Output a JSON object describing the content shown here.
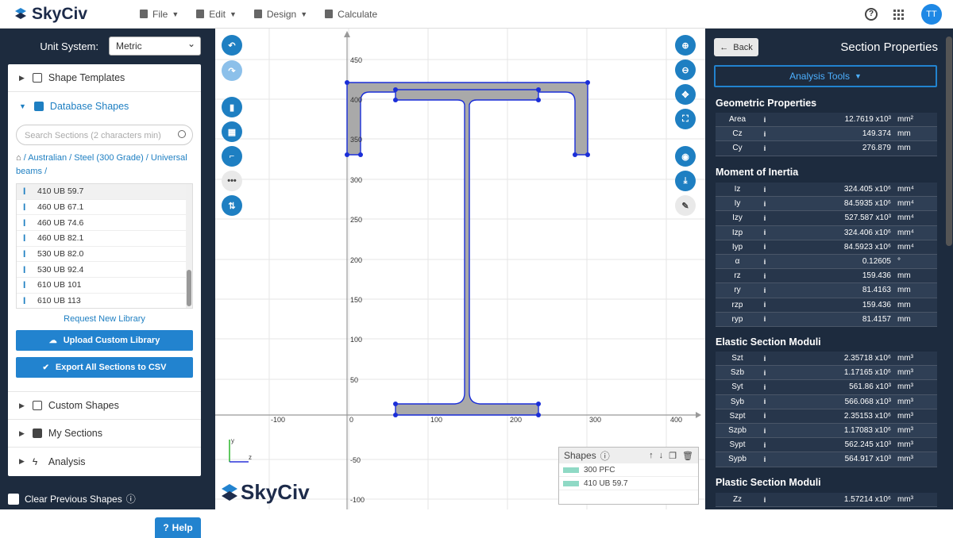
{
  "app": {
    "name": "SkyCiv",
    "menu": [
      {
        "label": "File"
      },
      {
        "label": "Edit"
      },
      {
        "label": "Design"
      },
      {
        "label": "Calculate"
      }
    ],
    "avatar": "TT"
  },
  "left": {
    "unit_label": "Unit System:",
    "unit_value": "Metric",
    "shape_templates": "Shape Templates",
    "database_shapes": "Database Shapes",
    "search_placeholder": "Search Sections (2 characters min)",
    "breadcrumb": "/ Australian / Steel (300 Grade) / Universal beams /",
    "items": [
      "410 UB 59.7",
      "460 UB 67.1",
      "460 UB 74.6",
      "460 UB 82.1",
      "530 UB 82.0",
      "530 UB 92.4",
      "610 UB 101",
      "610 UB 113"
    ],
    "request": "Request New Library",
    "upload": "Upload Custom Library",
    "export": "Export All Sections to CSV",
    "custom": "Custom Shapes",
    "mysections": "My Sections",
    "analysis": "Analysis",
    "clear": "Clear Previous Shapes",
    "help": "Help"
  },
  "canvas": {
    "x_ticks": [
      "-100",
      "0",
      "100",
      "200",
      "300",
      "400"
    ],
    "y_ticks": [
      "450",
      "400",
      "350",
      "300",
      "250",
      "200",
      "150",
      "100",
      "50",
      "-50",
      "-100"
    ],
    "axis_z": "z",
    "axis_y": "y",
    "watermark": "SkyCiv",
    "shapes_title": "Shapes",
    "shapes": [
      "300 PFC",
      "410 UB 59.7"
    ]
  },
  "right": {
    "back": "Back",
    "title": "Section Properties",
    "analysis_tools": "Analysis Tools",
    "sections": [
      {
        "title": "Geometric Properties",
        "rows": [
          {
            "n": "Area",
            "v": "12.7619 x10³",
            "u": "mm²"
          },
          {
            "n": "Cz",
            "v": "149.374",
            "u": "mm"
          },
          {
            "n": "Cy",
            "v": "276.879",
            "u": "mm"
          }
        ]
      },
      {
        "title": "Moment of Inertia",
        "rows": [
          {
            "n": "Iz",
            "v": "324.405 x10⁶",
            "u": "mm⁴"
          },
          {
            "n": "Iy",
            "v": "84.5935 x10⁶",
            "u": "mm⁴"
          },
          {
            "n": "Izy",
            "v": "527.587 x10³",
            "u": "mm⁴"
          },
          {
            "n": "Izp",
            "v": "324.406 x10⁶",
            "u": "mm⁴"
          },
          {
            "n": "Iyp",
            "v": "84.5923 x10⁶",
            "u": "mm⁴"
          },
          {
            "n": "α",
            "v": "0.12605",
            "u": "°"
          },
          {
            "n": "rz",
            "v": "159.436",
            "u": "mm"
          },
          {
            "n": "ry",
            "v": "81.4163",
            "u": "mm"
          },
          {
            "n": "rzp",
            "v": "159.436",
            "u": "mm"
          },
          {
            "n": "ryp",
            "v": "81.4157",
            "u": "mm"
          }
        ]
      },
      {
        "title": "Elastic Section Moduli",
        "rows": [
          {
            "n": "Szt",
            "v": "2.35718 x10⁶",
            "u": "mm³"
          },
          {
            "n": "Szb",
            "v": "1.17165 x10⁶",
            "u": "mm³"
          },
          {
            "n": "Syt",
            "v": "561.86 x10³",
            "u": "mm³"
          },
          {
            "n": "Syb",
            "v": "566.068 x10³",
            "u": "mm³"
          },
          {
            "n": "Szpt",
            "v": "2.35153 x10⁶",
            "u": "mm³"
          },
          {
            "n": "Szpb",
            "v": "1.17083 x10⁶",
            "u": "mm³"
          },
          {
            "n": "Sypt",
            "v": "562.245 x10³",
            "u": "mm³"
          },
          {
            "n": "Sypb",
            "v": "564.917 x10³",
            "u": "mm³"
          }
        ]
      },
      {
        "title": "Plastic Section Moduli",
        "rows": [
          {
            "n": "Zz",
            "v": "1.57214 x10⁶",
            "u": "mm³"
          }
        ]
      }
    ]
  }
}
